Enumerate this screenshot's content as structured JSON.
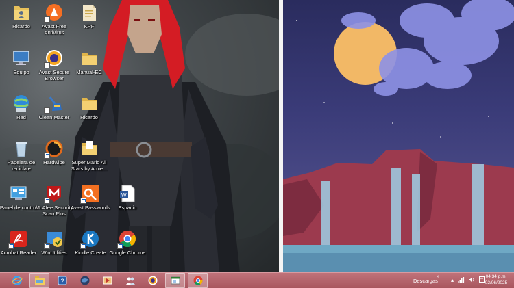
{
  "desktop_icons": [
    {
      "id": "ricardo-top",
      "label": "Ricardo",
      "icon": "user-folder-icon"
    },
    {
      "id": "avast-free",
      "label": "Avast Free Antivirus",
      "icon": "avast-icon"
    },
    {
      "id": "kpf",
      "label": "KPF",
      "icon": "document-folder-icon"
    },
    {
      "id": "equipo",
      "label": "Equipo",
      "icon": "computer-icon"
    },
    {
      "id": "avast-secure",
      "label": "Avast Secure Browser",
      "icon": "avast-browser-icon"
    },
    {
      "id": "manual-ec",
      "label": "Manual-EC",
      "icon": "folder-icon"
    },
    {
      "id": "red",
      "label": "Red",
      "icon": "network-icon"
    },
    {
      "id": "clean-master",
      "label": "Clean Master",
      "icon": "broom-icon"
    },
    {
      "id": "ricardo-folder",
      "label": "Ricardo",
      "icon": "folder-icon"
    },
    {
      "id": "papelera",
      "label": "Papelera de reciclaje",
      "icon": "recycle-bin-icon"
    },
    {
      "id": "hardwipe",
      "label": "Hardwipe",
      "icon": "hardwipe-icon"
    },
    {
      "id": "super-mario",
      "label": "Super Mario All Stars by Amie...",
      "icon": "folder-icon"
    },
    {
      "id": "panel-control",
      "label": "Panel de control",
      "icon": "control-panel-icon"
    },
    {
      "id": "mcafee",
      "label": "McAfee Security Scan Plus",
      "icon": "mcafee-icon"
    },
    {
      "id": "avast-passwords",
      "label": "Avast Passwords",
      "icon": "key-icon"
    },
    {
      "id": "espacio",
      "label": "Espacio",
      "icon": "document-icon"
    },
    {
      "id": "acrobat",
      "label": "Acrobat Reader",
      "icon": "acrobat-icon"
    },
    {
      "id": "winutilities",
      "label": "WinUtilities",
      "icon": "winutilities-icon"
    },
    {
      "id": "kindle",
      "label": "Kindle Create",
      "icon": "kindle-icon"
    },
    {
      "id": "chrome",
      "label": "Google Chrome",
      "icon": "chrome-icon"
    }
  ],
  "taskbar": {
    "pinned": [
      {
        "icon": "internet-explorer-icon",
        "active": false
      },
      {
        "icon": "file-explorer-icon",
        "active": true
      },
      {
        "icon": "help-icon",
        "active": false
      },
      {
        "icon": "globe-app-icon",
        "active": false
      },
      {
        "icon": "media-player-icon",
        "active": false
      },
      {
        "icon": "people-app-icon",
        "active": false
      },
      {
        "icon": "avast-browser-icon",
        "active": false
      },
      {
        "icon": "window-app-icon",
        "active": true
      },
      {
        "icon": "chrome-icon",
        "active": true
      }
    ],
    "toolbar_label": "Descargas",
    "toolbar_chevron": "»",
    "clock_time": "04:34 p.m.",
    "clock_date": "02/06/2025"
  },
  "colors": {
    "taskbar": "#b0606a",
    "divider_left": "#9b3a44",
    "moon": "#f2b866",
    "leaves": "#8e92e6"
  }
}
